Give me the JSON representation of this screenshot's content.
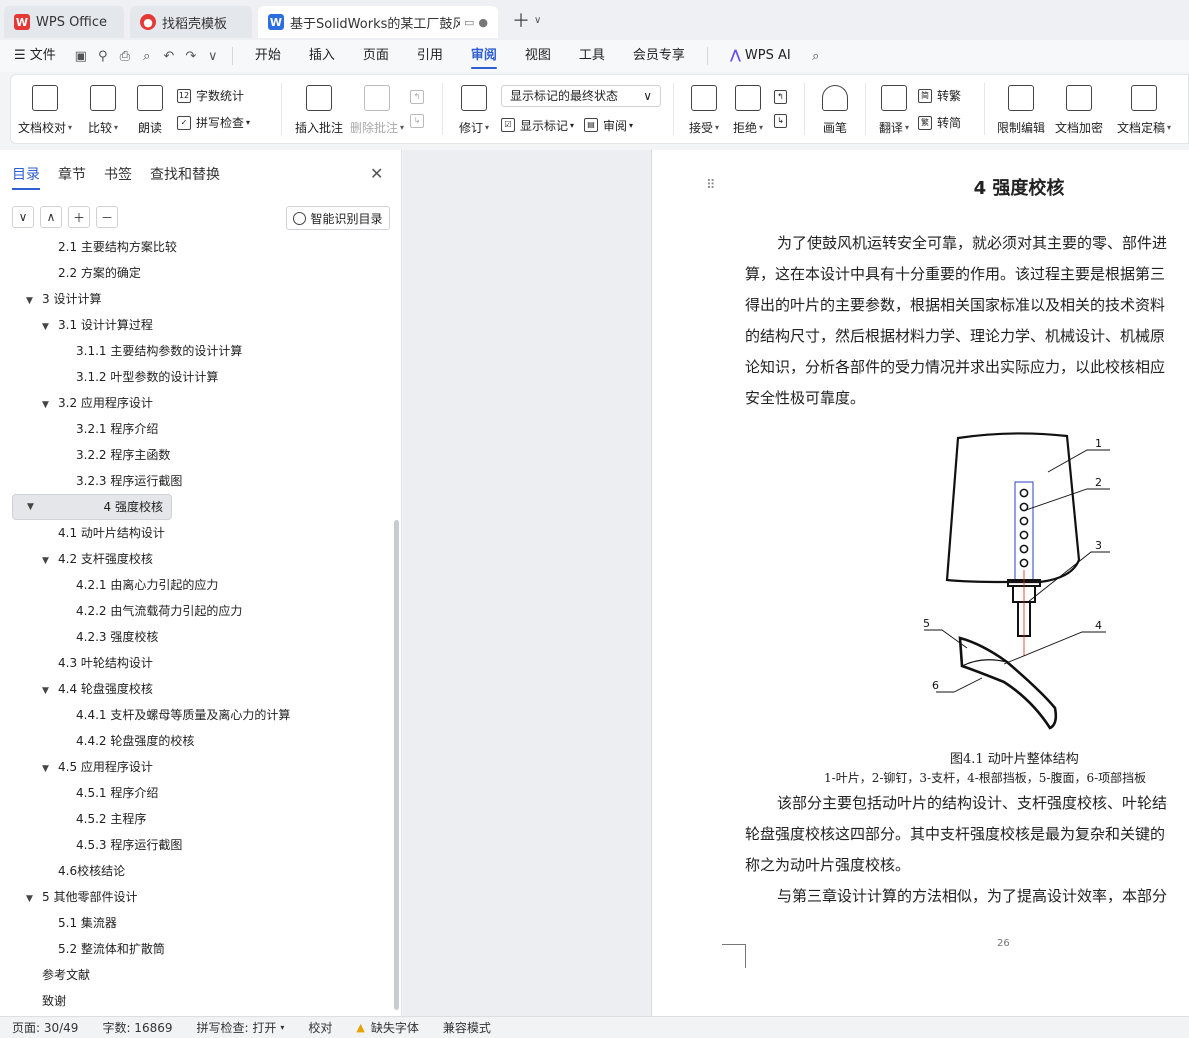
{
  "tabs": [
    {
      "label": "WPS Office",
      "icon": "wps-logo-icon"
    },
    {
      "label": "找稻壳模板",
      "icon": "docer-icon"
    },
    {
      "label": "基于SolidWorks的某工厂鼓风",
      "icon": "word-doc-icon"
    }
  ],
  "menu": {
    "file": "文件",
    "items": [
      "开始",
      "插入",
      "页面",
      "引用",
      "审阅",
      "视图",
      "工具",
      "会员专享"
    ],
    "active": "审阅",
    "ai": "WPS AI"
  },
  "ribbon": {
    "doc_proof": "文档校对",
    "compare": "比较",
    "read_aloud": "朗读",
    "word_count": "字数统计",
    "spell_check": "拼写检查",
    "insert_comment": "插入批注",
    "delete_comment": "删除批注",
    "track": "修订",
    "markup_state": "显示标记的最终状态",
    "show_markup": "显示标记",
    "review": "审阅",
    "accept": "接受",
    "reject": "拒绝",
    "pen": "画笔",
    "translate": "翻译",
    "to_traditional": "转繁",
    "to_simplified": "转简",
    "restrict_edit": "限制编辑",
    "encrypt": "文档加密",
    "finalize": "文档定稿"
  },
  "leftpane": {
    "tabs": [
      "目录",
      "章节",
      "书签",
      "查找和替换"
    ],
    "smart_toc": "智能识别目录",
    "toc": [
      {
        "label": "2.1 主要结构方案比较",
        "level": 2,
        "toggle": ""
      },
      {
        "label": "2.2  方案的确定",
        "level": 2,
        "toggle": ""
      },
      {
        "label": "3  设计计算",
        "level": 1,
        "toggle": "▼"
      },
      {
        "label": "3.1  设计计算过程",
        "level": 2,
        "toggle": "▼"
      },
      {
        "label": "3.1.1  主要结构参数的设计计算",
        "level": 3,
        "toggle": ""
      },
      {
        "label": "3.1.2  叶型参数的设计计算",
        "level": 3,
        "toggle": ""
      },
      {
        "label": "3.2  应用程序设计",
        "level": 2,
        "toggle": "▼"
      },
      {
        "label": "3.2.1  程序介绍",
        "level": 3,
        "toggle": ""
      },
      {
        "label": "3.2.2  程序主函数",
        "level": 3,
        "toggle": ""
      },
      {
        "label": "3.2.3  程序运行截图",
        "level": 3,
        "toggle": ""
      },
      {
        "label": "4  强度校核",
        "level": 1,
        "toggle": "▼",
        "selected": true
      },
      {
        "label": "4.1  动叶片结构设计",
        "level": 2,
        "toggle": ""
      },
      {
        "label": "4.2  支杆强度校核",
        "level": 2,
        "toggle": "▼"
      },
      {
        "label": "4.2.1  由离心力引起的应力",
        "level": 3,
        "toggle": ""
      },
      {
        "label": "4.2.2  由气流载荷力引起的应力",
        "level": 3,
        "toggle": ""
      },
      {
        "label": "4.2.3  强度校核",
        "level": 3,
        "toggle": ""
      },
      {
        "label": "4.3  叶轮结构设计",
        "level": 2,
        "toggle": ""
      },
      {
        "label": "4.4  轮盘强度校核",
        "level": 2,
        "toggle": "▼"
      },
      {
        "label": "4.4.1  支杆及螺母等质量及离心力的计算",
        "level": 3,
        "toggle": ""
      },
      {
        "label": "4.4.2  轮盘强度的校核",
        "level": 3,
        "toggle": ""
      },
      {
        "label": "4.5  应用程序设计",
        "level": 2,
        "toggle": "▼"
      },
      {
        "label": "4.5.1  程序介绍",
        "level": 3,
        "toggle": ""
      },
      {
        "label": "4.5.2  主程序",
        "level": 3,
        "toggle": ""
      },
      {
        "label": "4.5.3  程序运行截图",
        "level": 3,
        "toggle": ""
      },
      {
        "label": "4.6校核结论",
        "level": 2,
        "toggle": ""
      },
      {
        "label": "5  其他零部件设计",
        "level": 1,
        "toggle": "▼"
      },
      {
        "label": "5.1  集流器",
        "level": 2,
        "toggle": ""
      },
      {
        "label": "5.2  整流体和扩散筒",
        "level": 2,
        "toggle": ""
      },
      {
        "label": "参考文献",
        "level": 1,
        "toggle": ""
      },
      {
        "label": "致谢",
        "level": 1,
        "toggle": ""
      }
    ]
  },
  "document": {
    "heading": "4  强度校核",
    "para1": [
      "为了使鼓风机运转安全可靠，就必须对其主要的零、部件进",
      "算，这在本设计中具有十分重要的作用。该过程主要是根据第三",
      "得出的叶片的主要参数，根据相关国家标准以及相关的技术资料",
      "的结构尺寸，然后根据材料力学、理论力学、机械设计、机械原",
      "论知识，分析各部件的受力情况并求出实际应力，以此校核相应",
      "安全性极可靠度。"
    ],
    "figure_labels": [
      "1",
      "2",
      "3",
      "4",
      "5",
      "6"
    ],
    "figure_caption": "图4.1  动叶片整体结构",
    "figure_legend": "1-叶片，2-铆钉，3-支杆，4-根部挡板，5-腹面，6-项部挡板",
    "para2": [
      "该部分主要包括动叶片的结构设计、支杆强度校核、叶轮结",
      "轮盘强度校核这四部分。其中支杆强度校核是最为复杂和关键的",
      "称之为动叶片强度校核。"
    ],
    "para3": [
      "与第三章设计计算的方法相似，为了提高设计效率，本部分"
    ],
    "page_number": "26"
  },
  "status": {
    "page": "页面: 30/49",
    "words": "字数: 16869",
    "spell": "拼写检查: 打开",
    "proof": "校对",
    "missing_font": "缺失字体",
    "compat": "兼容模式"
  }
}
